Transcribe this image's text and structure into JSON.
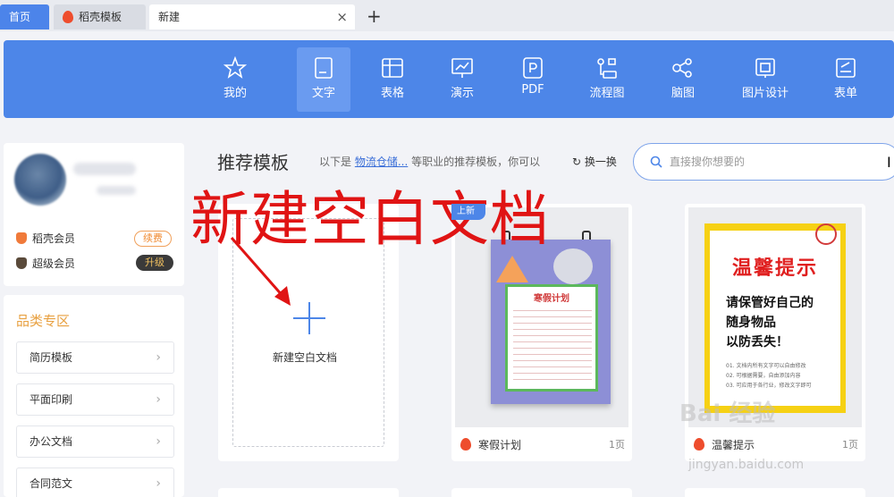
{
  "tabs": {
    "home": "首页",
    "daoke": "稻壳模板",
    "new": "新建",
    "close": "×",
    "add": "+"
  },
  "toolbar": {
    "items": [
      {
        "label": "我的",
        "icon": "star-icon"
      },
      {
        "label": "文字",
        "icon": "document-icon",
        "active": true
      },
      {
        "label": "表格",
        "icon": "table-icon"
      },
      {
        "label": "演示",
        "icon": "presentation-icon"
      },
      {
        "label": "PDF",
        "icon": "pdf-icon"
      },
      {
        "label": "流程图",
        "icon": "flowchart-icon"
      },
      {
        "label": "脑图",
        "icon": "mindmap-icon"
      },
      {
        "label": "图片设计",
        "icon": "image-design-icon"
      },
      {
        "label": "表单",
        "icon": "form-icon"
      }
    ],
    "bg_color": "#4d86e8"
  },
  "profile": {
    "daoke_member": "稻壳会员",
    "super_member": "超级会员",
    "renew": "续费",
    "upgrade": "升级"
  },
  "categories": {
    "title": "品类专区",
    "items": [
      "简历模板",
      "平面印刷",
      "办公文档",
      "合同范文"
    ]
  },
  "main": {
    "title": "推荐模板",
    "sub_prefix": "以下是",
    "sub_link": "物流仓储...",
    "sub_suffix": "等职业的推荐模板，你可以",
    "refresh": "换一换",
    "search_placeholder": "直接搜你想要的"
  },
  "overlay": "新建空白文档",
  "cards": {
    "blank_label": "新建空白文档",
    "t1": {
      "badge": "上新",
      "name": "寒假计划",
      "pages": "1页",
      "poster_title": "寒假计划"
    },
    "t2": {
      "name": "温馨提示",
      "pages": "1页",
      "poster_title": "温馨提示",
      "poster_body": [
        "请保管好自己的",
        "随身物品",
        "以防丢失！"
      ],
      "poster_small": [
        "01. 文档内所有文字可以自由修改",
        "02. 可根据需要，自由添加内容",
        "03. 可应用于各行业，修改文字即可"
      ]
    }
  },
  "watermark": {
    "main": "Bai 经验",
    "sub": "jingyan.baidu.com"
  }
}
